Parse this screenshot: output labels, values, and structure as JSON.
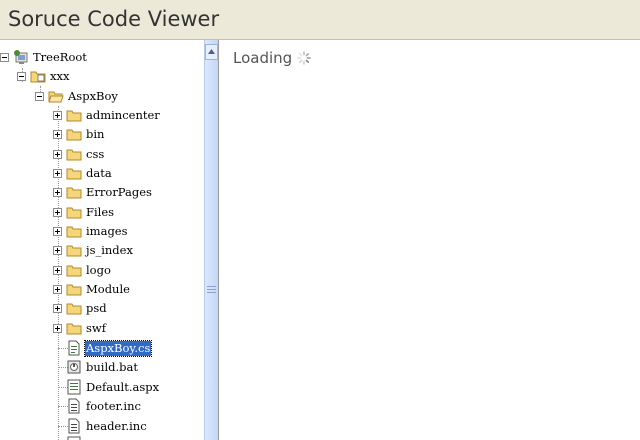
{
  "window": {
    "title": "Soruce Code Viewer"
  },
  "content": {
    "loading_text": "Loading"
  },
  "tree": {
    "root": "TreeRoot",
    "project": "xxx",
    "site": "AspxBoy",
    "folders": [
      "admincenter",
      "bin",
      "css",
      "data",
      "ErrorPages",
      "Files",
      "images",
      "js_index",
      "logo",
      "Module",
      "psd",
      "swf"
    ],
    "files": [
      {
        "name": "AspxBoy.cs",
        "icon": "cs-file-icon",
        "selected": true
      },
      {
        "name": "build.bat",
        "icon": "bat-file-icon",
        "selected": false
      },
      {
        "name": "Default.aspx",
        "icon": "aspx-file-icon",
        "selected": false
      },
      {
        "name": "footer.inc",
        "icon": "inc-file-icon",
        "selected": false
      },
      {
        "name": "header.inc",
        "icon": "inc-file-icon",
        "selected": false
      }
    ]
  },
  "colors": {
    "title_bar": "#ece9d8",
    "selection": "#316ac5",
    "folder": "#f5d67a",
    "scrollbar": "#c3d6f8"
  }
}
